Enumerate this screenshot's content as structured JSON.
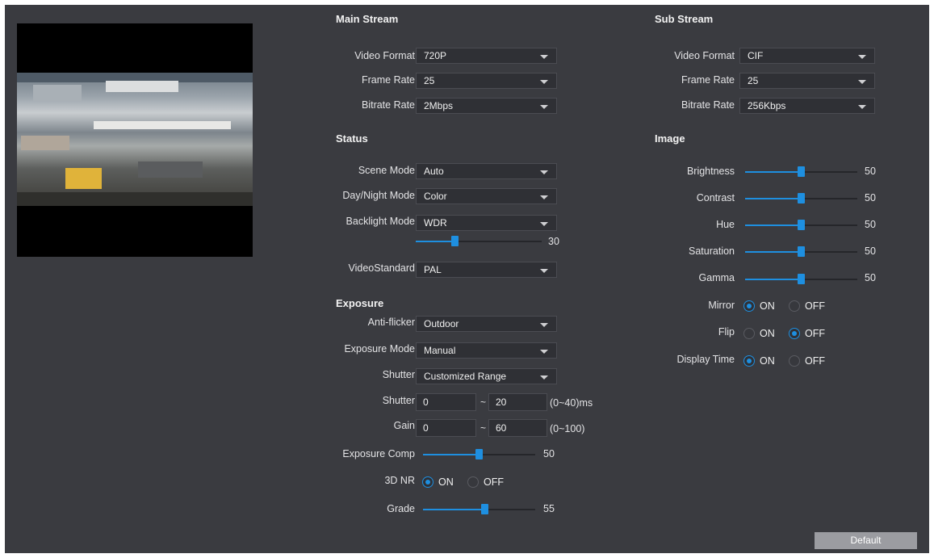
{
  "main_stream": {
    "title": "Main Stream",
    "video_format": {
      "label": "Video Format",
      "value": "720P"
    },
    "frame_rate": {
      "label": "Frame Rate",
      "value": "25"
    },
    "bitrate_rate": {
      "label": "Bitrate Rate",
      "value": "2Mbps"
    }
  },
  "sub_stream": {
    "title": "Sub Stream",
    "video_format": {
      "label": "Video Format",
      "value": "CIF"
    },
    "frame_rate": {
      "label": "Frame Rate",
      "value": "25"
    },
    "bitrate_rate": {
      "label": "Bitrate Rate",
      "value": "256Kbps"
    }
  },
  "status": {
    "title": "Status",
    "scene_mode": {
      "label": "Scene Mode",
      "value": "Auto"
    },
    "day_night_mode": {
      "label": "Day/Night Mode",
      "value": "Color"
    },
    "backlight_mode": {
      "label": "Backlight Mode",
      "value": "WDR",
      "level": 30,
      "level_text": "30",
      "max": 100
    },
    "video_standard": {
      "label": "VideoStandard",
      "value": "PAL"
    }
  },
  "exposure": {
    "title": "Exposure",
    "anti_flicker": {
      "label": "Anti-flicker",
      "value": "Outdoor"
    },
    "exposure_mode": {
      "label": "Exposure Mode",
      "value": "Manual"
    },
    "shutter_mode": {
      "label": "Shutter",
      "value": "Customized Range"
    },
    "shutter_range": {
      "label": "Shutter",
      "min": "0",
      "sep": "~",
      "max": "20",
      "unit": "(0~40)ms"
    },
    "gain_range": {
      "label": "Gain",
      "min": "0",
      "sep": "~",
      "max": "60",
      "unit": "(0~100)"
    },
    "exposure_comp": {
      "label": "Exposure Comp",
      "value": 50,
      "text": "50",
      "max": 100
    },
    "nr3d": {
      "label": "3D NR",
      "on_label": "ON",
      "off_label": "OFF",
      "selected": "ON"
    },
    "grade": {
      "label": "Grade",
      "value": 55,
      "text": "55",
      "max": 100
    }
  },
  "image": {
    "title": "Image",
    "brightness": {
      "label": "Brightness",
      "value": 50,
      "text": "50",
      "max": 100
    },
    "contrast": {
      "label": "Contrast",
      "value": 50,
      "text": "50",
      "max": 100
    },
    "hue": {
      "label": "Hue",
      "value": 50,
      "text": "50",
      "max": 100
    },
    "saturation": {
      "label": "Saturation",
      "value": 50,
      "text": "50",
      "max": 100
    },
    "gamma": {
      "label": "Gamma",
      "value": 50,
      "text": "50",
      "max": 100
    },
    "mirror": {
      "label": "Mirror",
      "on_label": "ON",
      "off_label": "OFF",
      "selected": "ON"
    },
    "flip": {
      "label": "Flip",
      "on_label": "ON",
      "off_label": "OFF",
      "selected": "OFF"
    },
    "display_time": {
      "label": "Display Time",
      "on_label": "ON",
      "off_label": "OFF",
      "selected": "ON"
    }
  },
  "buttons": {
    "default_label": "Default"
  },
  "colors": {
    "accent": "#1e8fe0",
    "panel_bg": "#3a3b40",
    "button_bg": "#9b9ca1"
  }
}
